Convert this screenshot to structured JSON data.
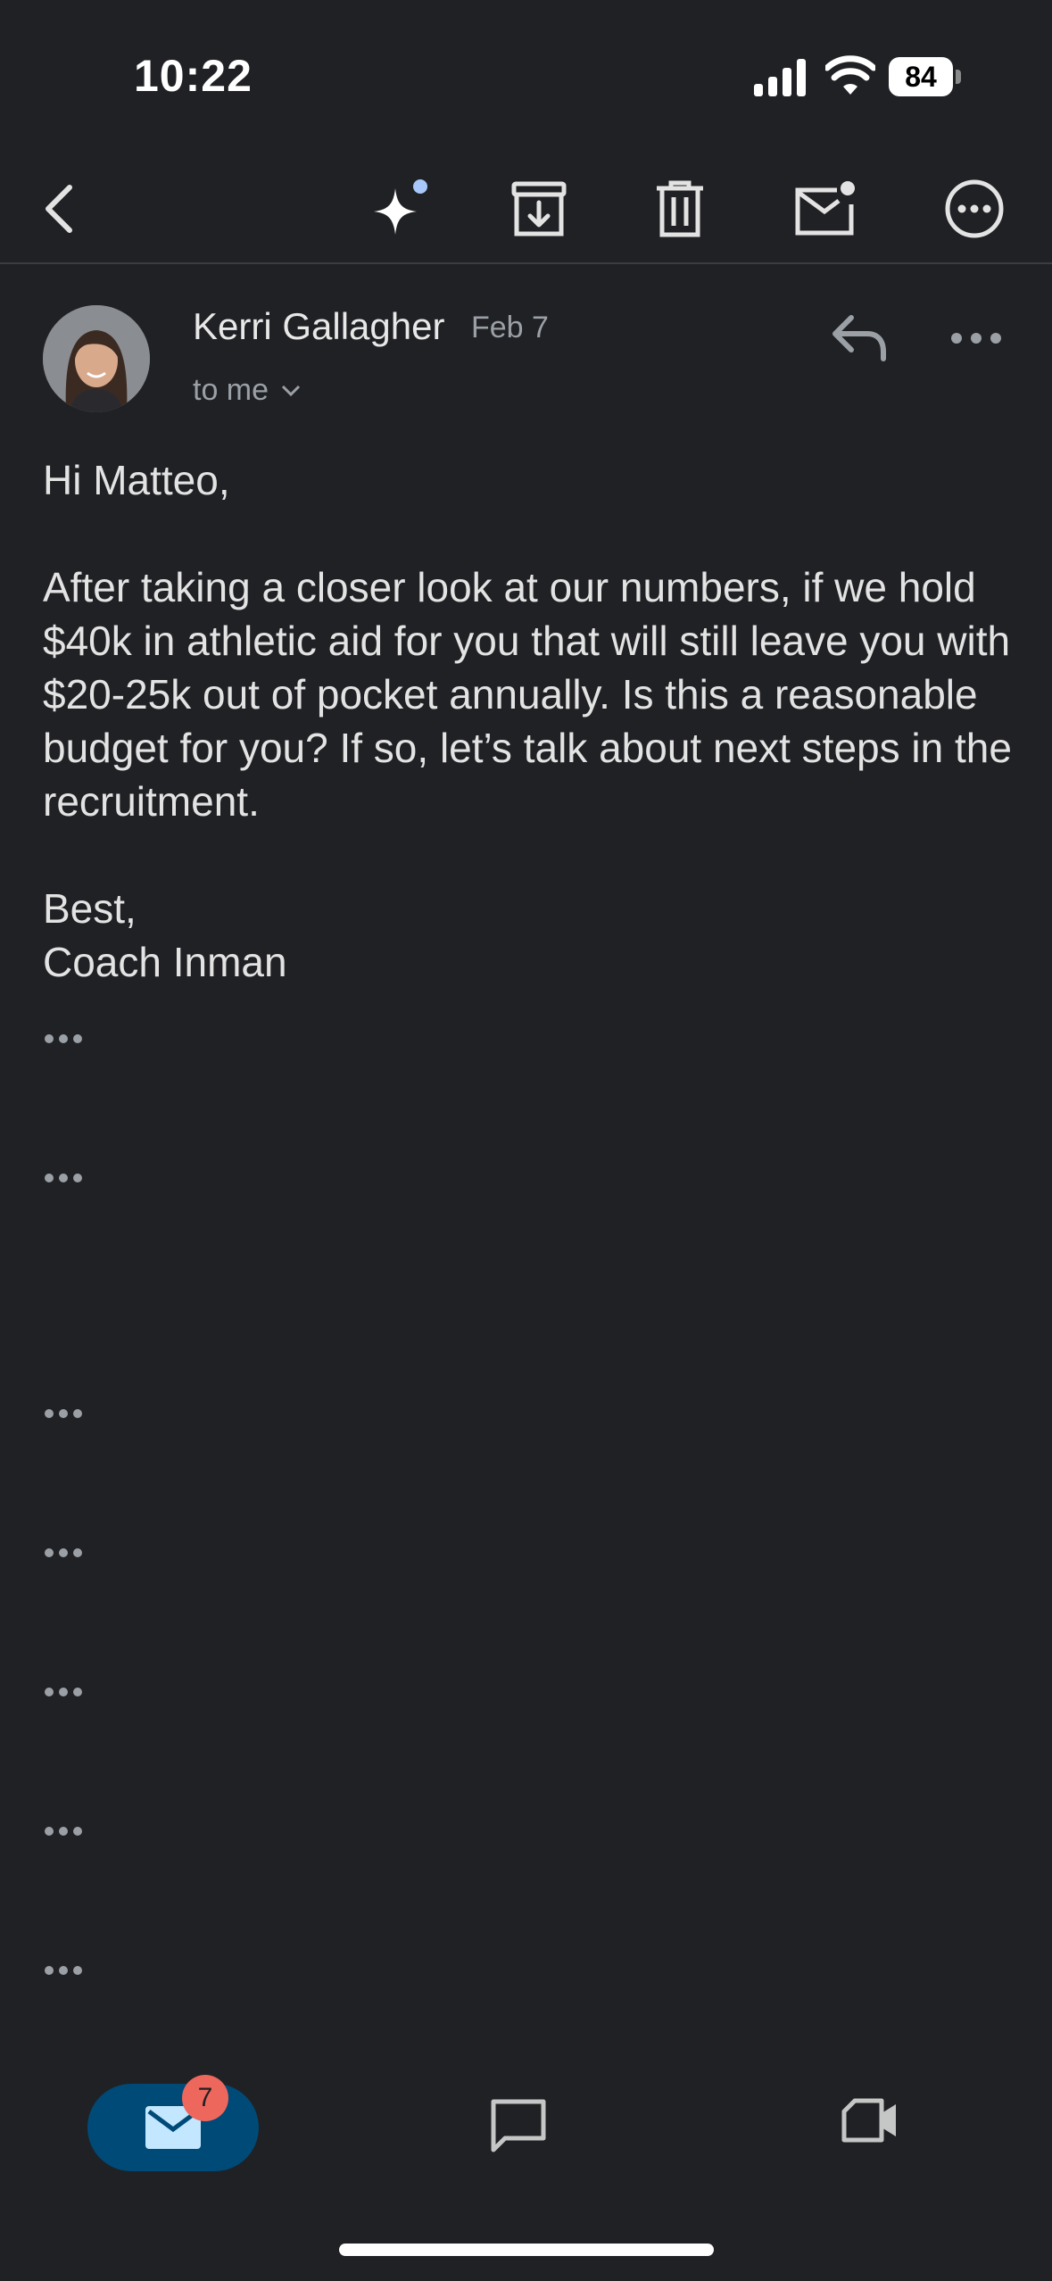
{
  "status_bar": {
    "time": "10:22",
    "battery": "84"
  },
  "toolbar": {
    "back_icon": "back-chevron-icon",
    "actions": [
      "sparkle-ai-icon",
      "archive-icon",
      "trash-icon",
      "mark-unread-icon",
      "more-options-icon"
    ],
    "ai_dot_color": "#a8c7fa"
  },
  "message": {
    "sender": "Kerri Gallagher",
    "date": "Feb 7",
    "recipient": "to me",
    "greeting": "Hi Matteo,",
    "body": "After taking a closer look at our numbers, if we hold $40k in athletic aid for you that will still leave you with $20-25k out of pocket annually. Is this a reasonable budget for you? If so, let’s talk about next steps in the recruitment.",
    "signoff": "Best,",
    "signature": "Coach Inman"
  },
  "bottom_nav": {
    "mail_badge": "7",
    "items": [
      "mail-icon",
      "chat-icon",
      "meet-video-icon"
    ],
    "active_color": "#004a77",
    "badge_color": "#ee675c"
  }
}
